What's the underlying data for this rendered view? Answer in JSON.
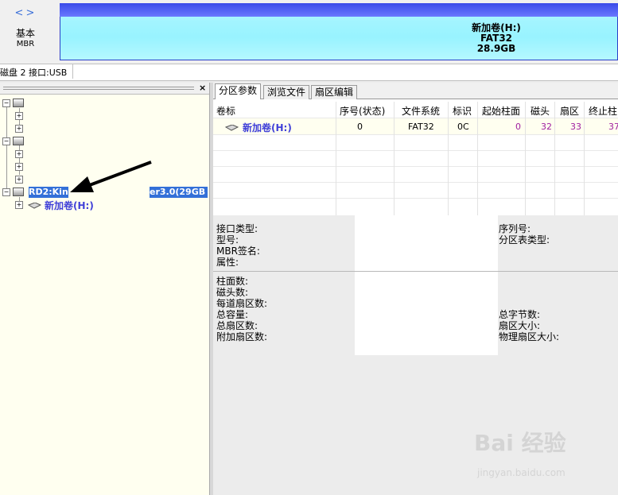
{
  "top": {
    "nav_back": "<",
    "nav_forward": ">",
    "disk_type_line1": "基本",
    "disk_type_line2": "MBR",
    "partition": {
      "name": "新加卷(H:)",
      "fs": "FAT32",
      "size": "28.9GB",
      "color_top": "#3a4ae8",
      "color_body": "#98f3ff"
    }
  },
  "infobar": {
    "text": "磁盘 2 接口:USB"
  },
  "tree": {
    "close": "×",
    "disk2_label": "RD2:Kin",
    "disk2_tail": "er3.0(29GB",
    "volume_label": "新加卷(H:)",
    "selection_color": "#3370d8"
  },
  "tabs": [
    "分区参数",
    "浏览文件",
    "扇区编辑"
  ],
  "table": {
    "headers": [
      "卷标",
      "序号(状态)",
      "文件系统",
      "标识",
      "起始柱面",
      "磁头",
      "扇区",
      "终止柱"
    ],
    "rows": [
      {
        "label": "新加卷(H:)",
        "index": "0",
        "fs": "FAT32",
        "id": "0C",
        "start_cyl": "0",
        "head": "32",
        "sector": "33",
        "end_cyl": "37"
      }
    ]
  },
  "info": {
    "left_top": [
      "接口类型:",
      "型号:",
      "MBR签名:",
      "属性:"
    ],
    "right_top": [
      "序列号:",
      "分区表类型:"
    ],
    "left_bottom": [
      "柱面数:",
      "磁头数:",
      "每道扇区数:",
      "总容量:",
      "总扇区数:",
      "附加扇区数:"
    ],
    "right_bottom": [
      "总字节数:",
      "扇区大小:",
      "物理扇区大小:"
    ]
  },
  "watermark": {
    "logo": "Bai 经验",
    "url": "jingyan.baidu.com"
  }
}
